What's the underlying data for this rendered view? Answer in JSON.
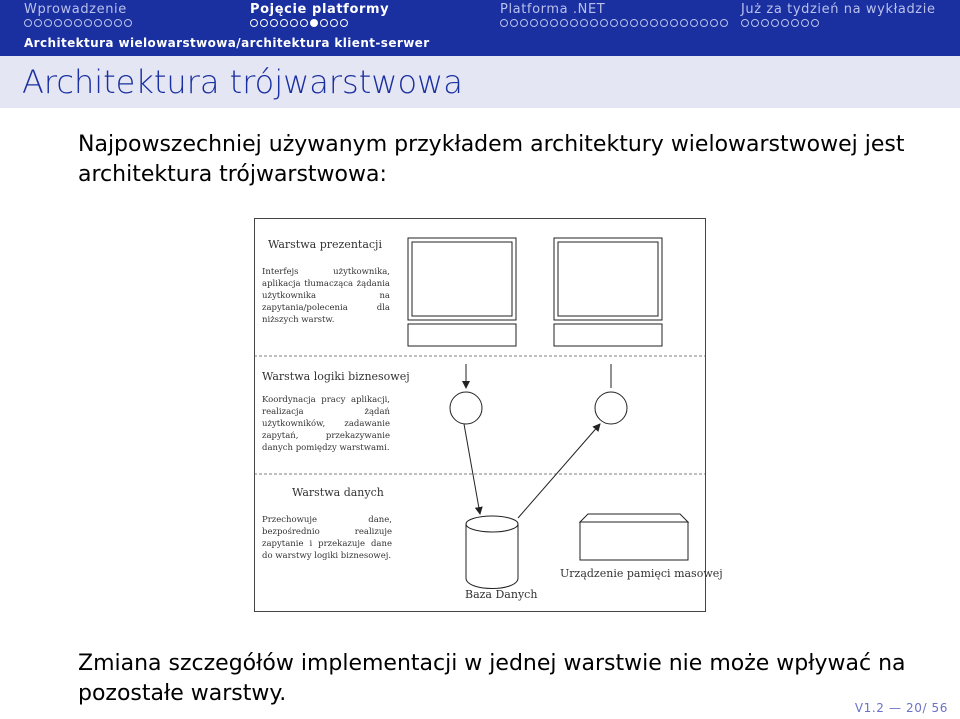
{
  "nav": {
    "sections": [
      {
        "title": "Wprowadzenie",
        "dots": 11,
        "filled_index": -1,
        "active": false
      },
      {
        "title": "Pojęcie platformy",
        "dots": 10,
        "filled_index": 6,
        "active": true
      },
      {
        "title": "Platforma .NET",
        "dots": 23,
        "filled_index": -1,
        "active": false
      },
      {
        "title": "Już za tydzień na wykładzie",
        "dots": 8,
        "filled_index": -1,
        "active": false
      }
    ],
    "subsection": "Architektura wielowarstwowa/architektura klient-serwer"
  },
  "frame": {
    "title": "Architektura trójwarstwowa",
    "intro": "Najpowszechniej używanym przykładem architektury wielowarstwowej jest architektura trójwarstwowa:",
    "conclusion": "Zmiana szczegółów implementacji w jednej warstwie nie może wpływać na pozostałe warstwy."
  },
  "diagram": {
    "layers": [
      {
        "title": "Warstwa prezentacji",
        "description": "Interfejs użytkownika, aplikacja tłumacząca żądania użytkownika na zapytania/polecenia dla niższych warstw."
      },
      {
        "title": "Warstwa logiki biznesowej",
        "description": "Koordynacja pracy aplikacji, realizacja żądań użytkowników, zadawanie zapytań, przekazywanie danych pomiędzy warstwami."
      },
      {
        "title": "Warstwa danych",
        "description": "Przechowuje dane, bezpośrednio realizuje zapytanie i przekazuje dane do warstwy logiki biznesowej."
      }
    ],
    "database_label": "Baza Danych",
    "storage_label": "Urządzenie pamięci masowej"
  },
  "footer": {
    "version": "V1.2",
    "separator": "—",
    "page": "20/ 56"
  },
  "colors": {
    "header_bg": "#1a2fa0",
    "title_bar_bg": "#e4e6f3",
    "title_color": "#1a2fa0",
    "footer_color": "#6a73c8"
  }
}
